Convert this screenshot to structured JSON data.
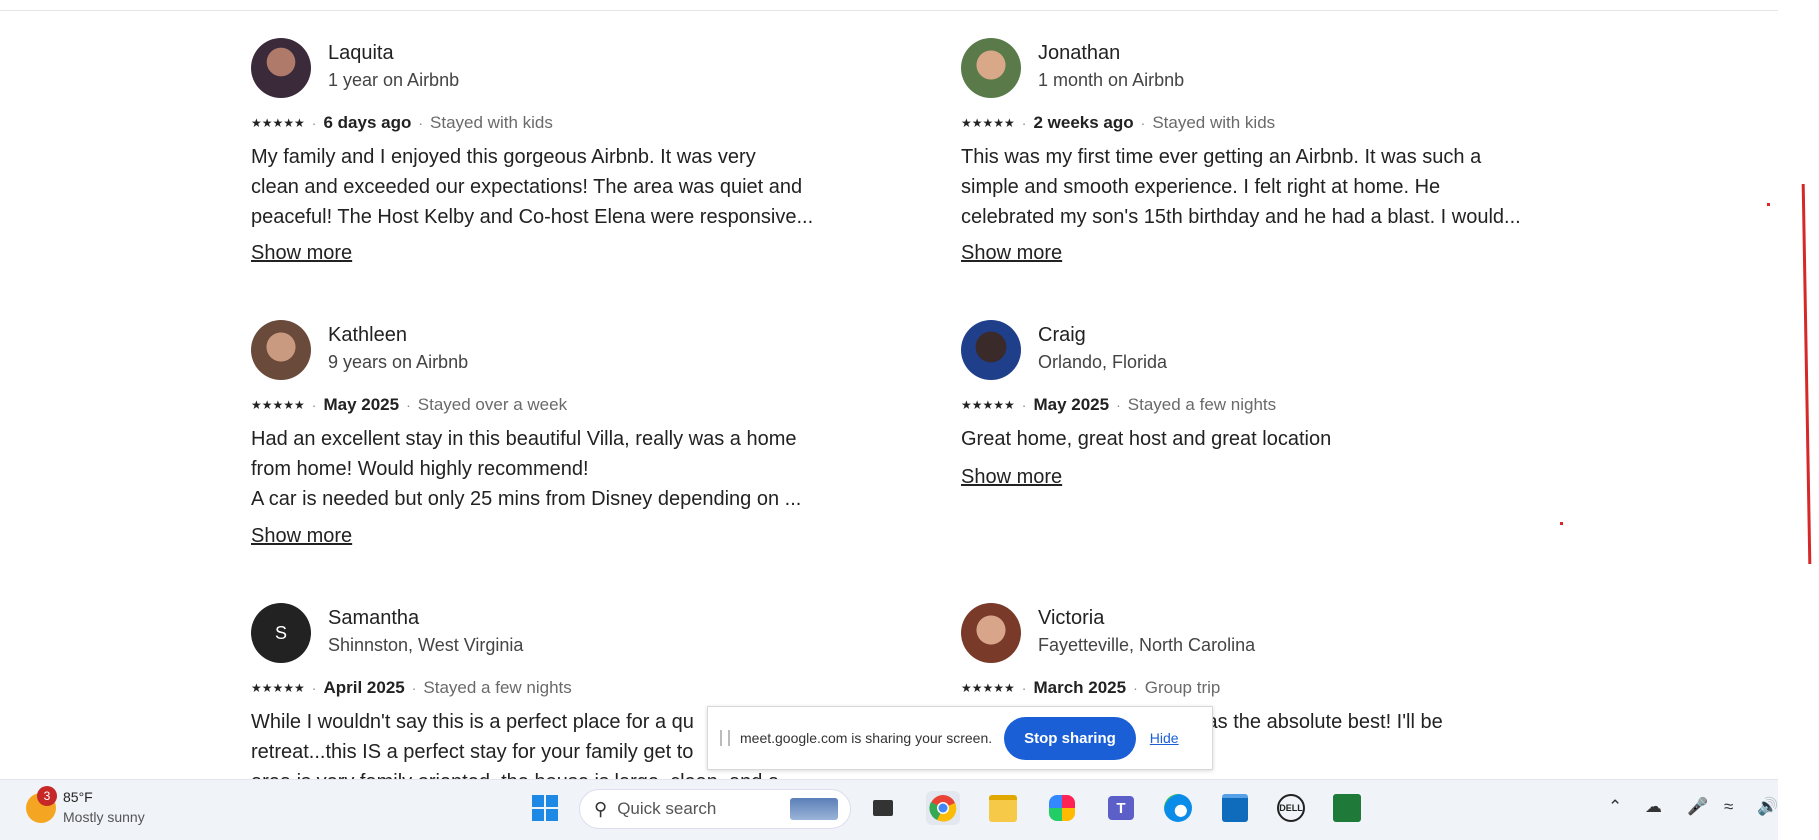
{
  "reviews": [
    {
      "name": "Laquita",
      "sub": "1 year on Airbnb",
      "stars": "★★★★★",
      "when": "6 days ago",
      "stay": "Stayed with kids",
      "lines": [
        "My family and I enjoyed this gorgeous Airbnb. It was very",
        "clean and exceeded our expectations! The area was quiet and",
        "peaceful! The Host Kelby and Co-host Elena were responsive..."
      ],
      "show": "Show more"
    },
    {
      "name": "Jonathan",
      "sub": "1 month on Airbnb",
      "stars": "★★★★★",
      "when": "2 weeks ago",
      "stay": "Stayed with kids",
      "lines": [
        "This was my first time ever getting an Airbnb. It was such a",
        "simple and smooth experience.  I felt right at home. He",
        "celebrated my son's 15th birthday and he had a blast. I would..."
      ],
      "show": "Show more"
    },
    {
      "name": "Kathleen",
      "sub": "9 years on Airbnb",
      "stars": "★★★★★",
      "when": "May 2025",
      "stay": "Stayed over a week",
      "lines": [
        "Had an excellent stay in this beautiful Villa, really was a home",
        "from home! Would highly recommend!",
        "A car is needed but only 25 mins from Disney depending on ..."
      ],
      "show": "Show more"
    },
    {
      "name": "Craig",
      "sub": "Orlando, Florida",
      "stars": "★★★★★",
      "when": "May 2025",
      "stay": "Stayed a few nights",
      "lines": [
        "Great home, great host and great location"
      ],
      "show": "Show more"
    },
    {
      "name": "Samantha",
      "sub": "Shinnston, West Virginia",
      "stars": "★★★★★",
      "when": "April 2025",
      "stay": "Stayed a few nights",
      "initial": "S",
      "lines": [
        "While I wouldn't say this is a perfect place for a qu",
        "retreat...this IS a perfect stay for your family get to",
        "area is very family oriented, the house is large, clean, and a"
      ],
      "show": ""
    },
    {
      "name": "Victoria",
      "sub": "Fayetteville, North Carolina",
      "stars": "★★★★★",
      "when": "March 2025",
      "stay": "Group trip",
      "lines": [
        "st was the absolute best! I'll be"
      ],
      "show": ""
    }
  ],
  "share_bar": {
    "text": "meet.google.com is sharing your screen.",
    "stop": "Stop sharing",
    "hide": "Hide"
  },
  "taskbar": {
    "weather": {
      "badge": "3",
      "temp": "85°F",
      "condition": "Mostly sunny"
    },
    "search_placeholder": "Quick search",
    "icons": [
      "windows-start-icon",
      "task-view-icon",
      "chrome-icon",
      "file-explorer-icon",
      "copilot-icon",
      "teams-icon",
      "edge-icon",
      "store-icon",
      "dell-icon",
      "app-icon"
    ],
    "tray": [
      "chevron-up-icon",
      "cloud-off-icon",
      "microphone-icon",
      "wifi-icon",
      "speaker-icon"
    ]
  },
  "colors": {
    "accent": "#1a5fd6",
    "annotation": "#d62828"
  }
}
